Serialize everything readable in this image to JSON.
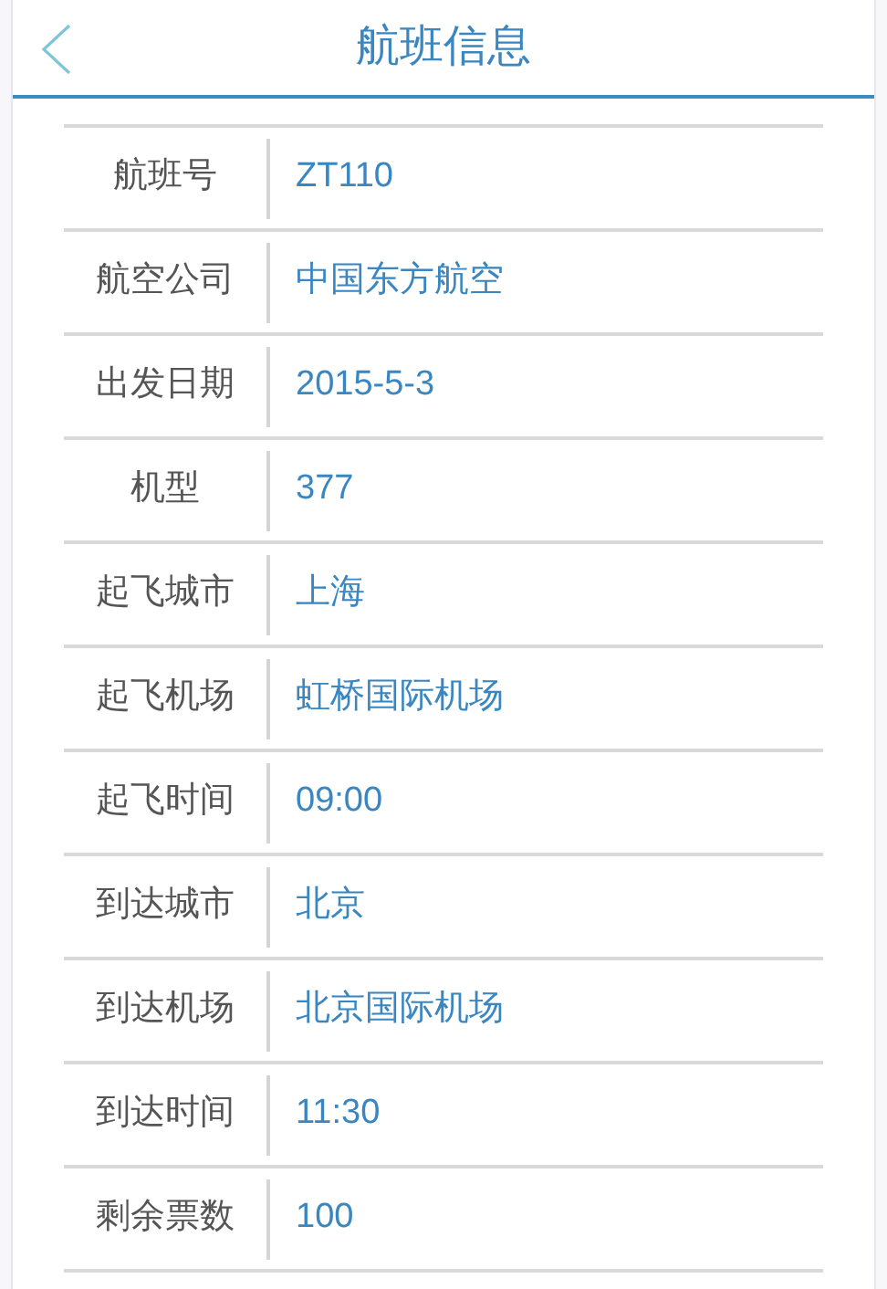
{
  "header": {
    "title": "航班信息"
  },
  "rows": [
    {
      "label": "航班号",
      "value": "ZT110"
    },
    {
      "label": "航空公司",
      "value": "中国东方航空"
    },
    {
      "label": "出发日期",
      "value": "2015-5-3"
    },
    {
      "label": "机型",
      "value": "377"
    },
    {
      "label": "起飞城市",
      "value": "上海"
    },
    {
      "label": "起飞机场",
      "value": "虹桥国际机场"
    },
    {
      "label": "起飞时间",
      "value": "09:00"
    },
    {
      "label": "到达城市",
      "value": "北京"
    },
    {
      "label": "到达机场",
      "value": "北京国际机场"
    },
    {
      "label": "到达时间",
      "value": "11:30"
    },
    {
      "label": "剩余票数",
      "value": "100"
    }
  ]
}
